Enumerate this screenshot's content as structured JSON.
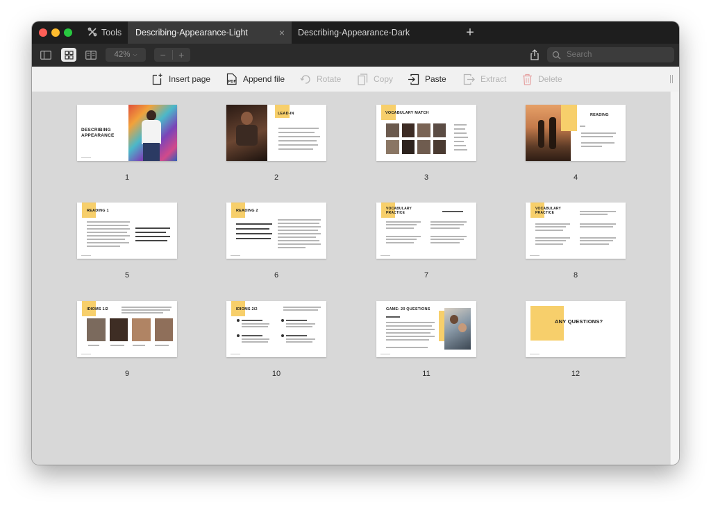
{
  "tabs": {
    "tools_label": "Tools",
    "active_label": "Describing-Appearance-Light",
    "second_label": "Describing-Appearance-Dark",
    "close_glyph": "×",
    "new_glyph": "+"
  },
  "toolbar": {
    "zoom_value": "42%",
    "zoom_minus": "−",
    "zoom_plus": "+",
    "search_placeholder": "Search"
  },
  "actions": [
    {
      "label": "Insert page",
      "icon": "insert-page-icon",
      "enabled": true
    },
    {
      "label": "Append file",
      "icon": "append-pdf-icon",
      "enabled": true
    },
    {
      "label": "Rotate",
      "icon": "rotate-icon",
      "enabled": false
    },
    {
      "label": "Copy",
      "icon": "copy-icon",
      "enabled": false
    },
    {
      "label": "Paste",
      "icon": "paste-icon",
      "enabled": true
    },
    {
      "label": "Extract",
      "icon": "extract-icon",
      "enabled": false
    },
    {
      "label": "Delete",
      "icon": "trash-icon",
      "enabled": false
    }
  ],
  "colors": {
    "accent_yellow": "#f7cf6b",
    "titlebar": "#1e1e1e",
    "toolbar": "#2b2b2b",
    "actionbar": "#f1f1f1",
    "grid_background": "#d8d8d8"
  },
  "pages": [
    {
      "number": "1",
      "title": "DESCRIBING APPEARANCE"
    },
    {
      "number": "2",
      "title": "LEAD-IN"
    },
    {
      "number": "3",
      "title": "VOCABULARY MATCH"
    },
    {
      "number": "4",
      "title": "READING"
    },
    {
      "number": "5",
      "title": "READING 1"
    },
    {
      "number": "6",
      "title": "READING 2"
    },
    {
      "number": "7",
      "title": "VOCABULARY PRACTICE"
    },
    {
      "number": "8",
      "title": "VOCABULARY PRACTICE"
    },
    {
      "number": "9",
      "title": "IDIOMS 1/2"
    },
    {
      "number": "10",
      "title": "IDIOMS 2/2"
    },
    {
      "number": "11",
      "title": "GAME: 20 QUESTIONS"
    },
    {
      "number": "12",
      "title": "ANY QUESTIONS?"
    }
  ]
}
